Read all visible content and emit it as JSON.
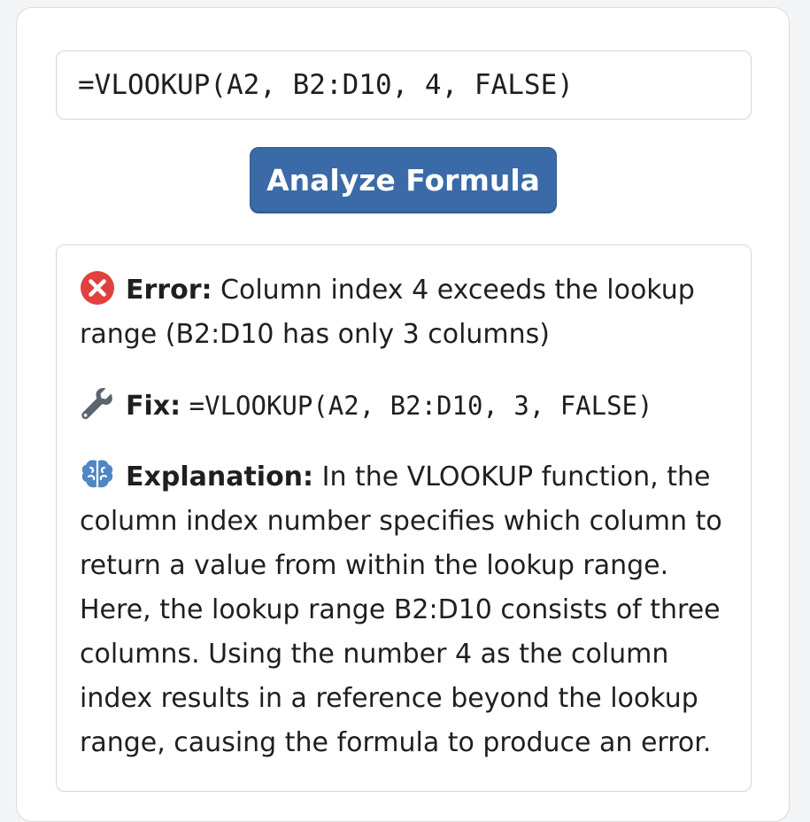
{
  "formula_input": {
    "value": "=VLOOKUP(A2, B2:D10, 4, FALSE)"
  },
  "analyze_button": {
    "label": "Analyze Formula"
  },
  "result": {
    "error": {
      "icon": "error-x-circle-icon",
      "label": "Error:",
      "text": "Column index 4 exceeds the lookup range (B2:D10 has only 3 columns)"
    },
    "fix": {
      "icon": "wrench-icon",
      "label": "Fix:",
      "formula": "=VLOOKUP(A2, B2:D10, 3, FALSE)"
    },
    "explanation": {
      "icon": "brain-icon",
      "label": "Explanation:",
      "text": "In the VLOOKUP function, the column index number specifies which column to return a value from within the lookup range. Here, the lookup range B2:D10 consists of three columns. Using the number 4 as the column index results in a reference beyond the lookup range, causing the formula to produce an error."
    }
  },
  "colors": {
    "button": "#3a6aa8",
    "error_icon": "#e0413f",
    "brain_icon": "#4f86c6",
    "wrench_icon": "#5b6570"
  }
}
